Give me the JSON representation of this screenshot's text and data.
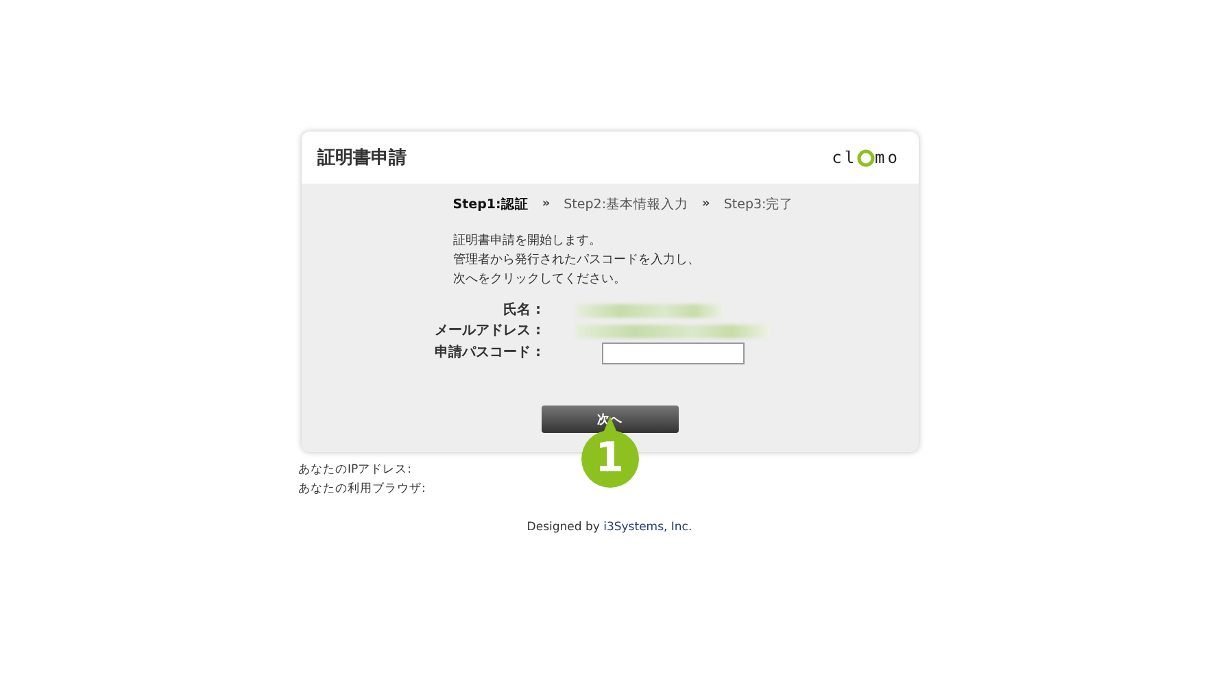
{
  "header": {
    "title": "証明書申請",
    "logo": {
      "left": "cl",
      "right": "mo"
    }
  },
  "steps": [
    {
      "label": "Step1:認証",
      "selected": true
    },
    {
      "label": "Step2:基本情報入力",
      "selected": false
    },
    {
      "label": "Step3:完了",
      "selected": false
    }
  ],
  "step_separator": "»",
  "intro": [
    "証明書申請を開始します。",
    "管理者から発行されたパスコードを入力し、",
    "次へをクリックしてください。"
  ],
  "fields": [
    {
      "label": "氏名 :",
      "kind": "blurred"
    },
    {
      "label": "メールアドレス :",
      "kind": "blurred"
    },
    {
      "label": "申請パスコード :",
      "kind": "input"
    }
  ],
  "next_button": "次へ",
  "callout": "1",
  "client_info": [
    "あなたのIPアドレス:",
    "あなたの利用ブラウザ:"
  ],
  "footer": {
    "prefix": "Designed by ",
    "link": "i3Systems, Inc."
  }
}
